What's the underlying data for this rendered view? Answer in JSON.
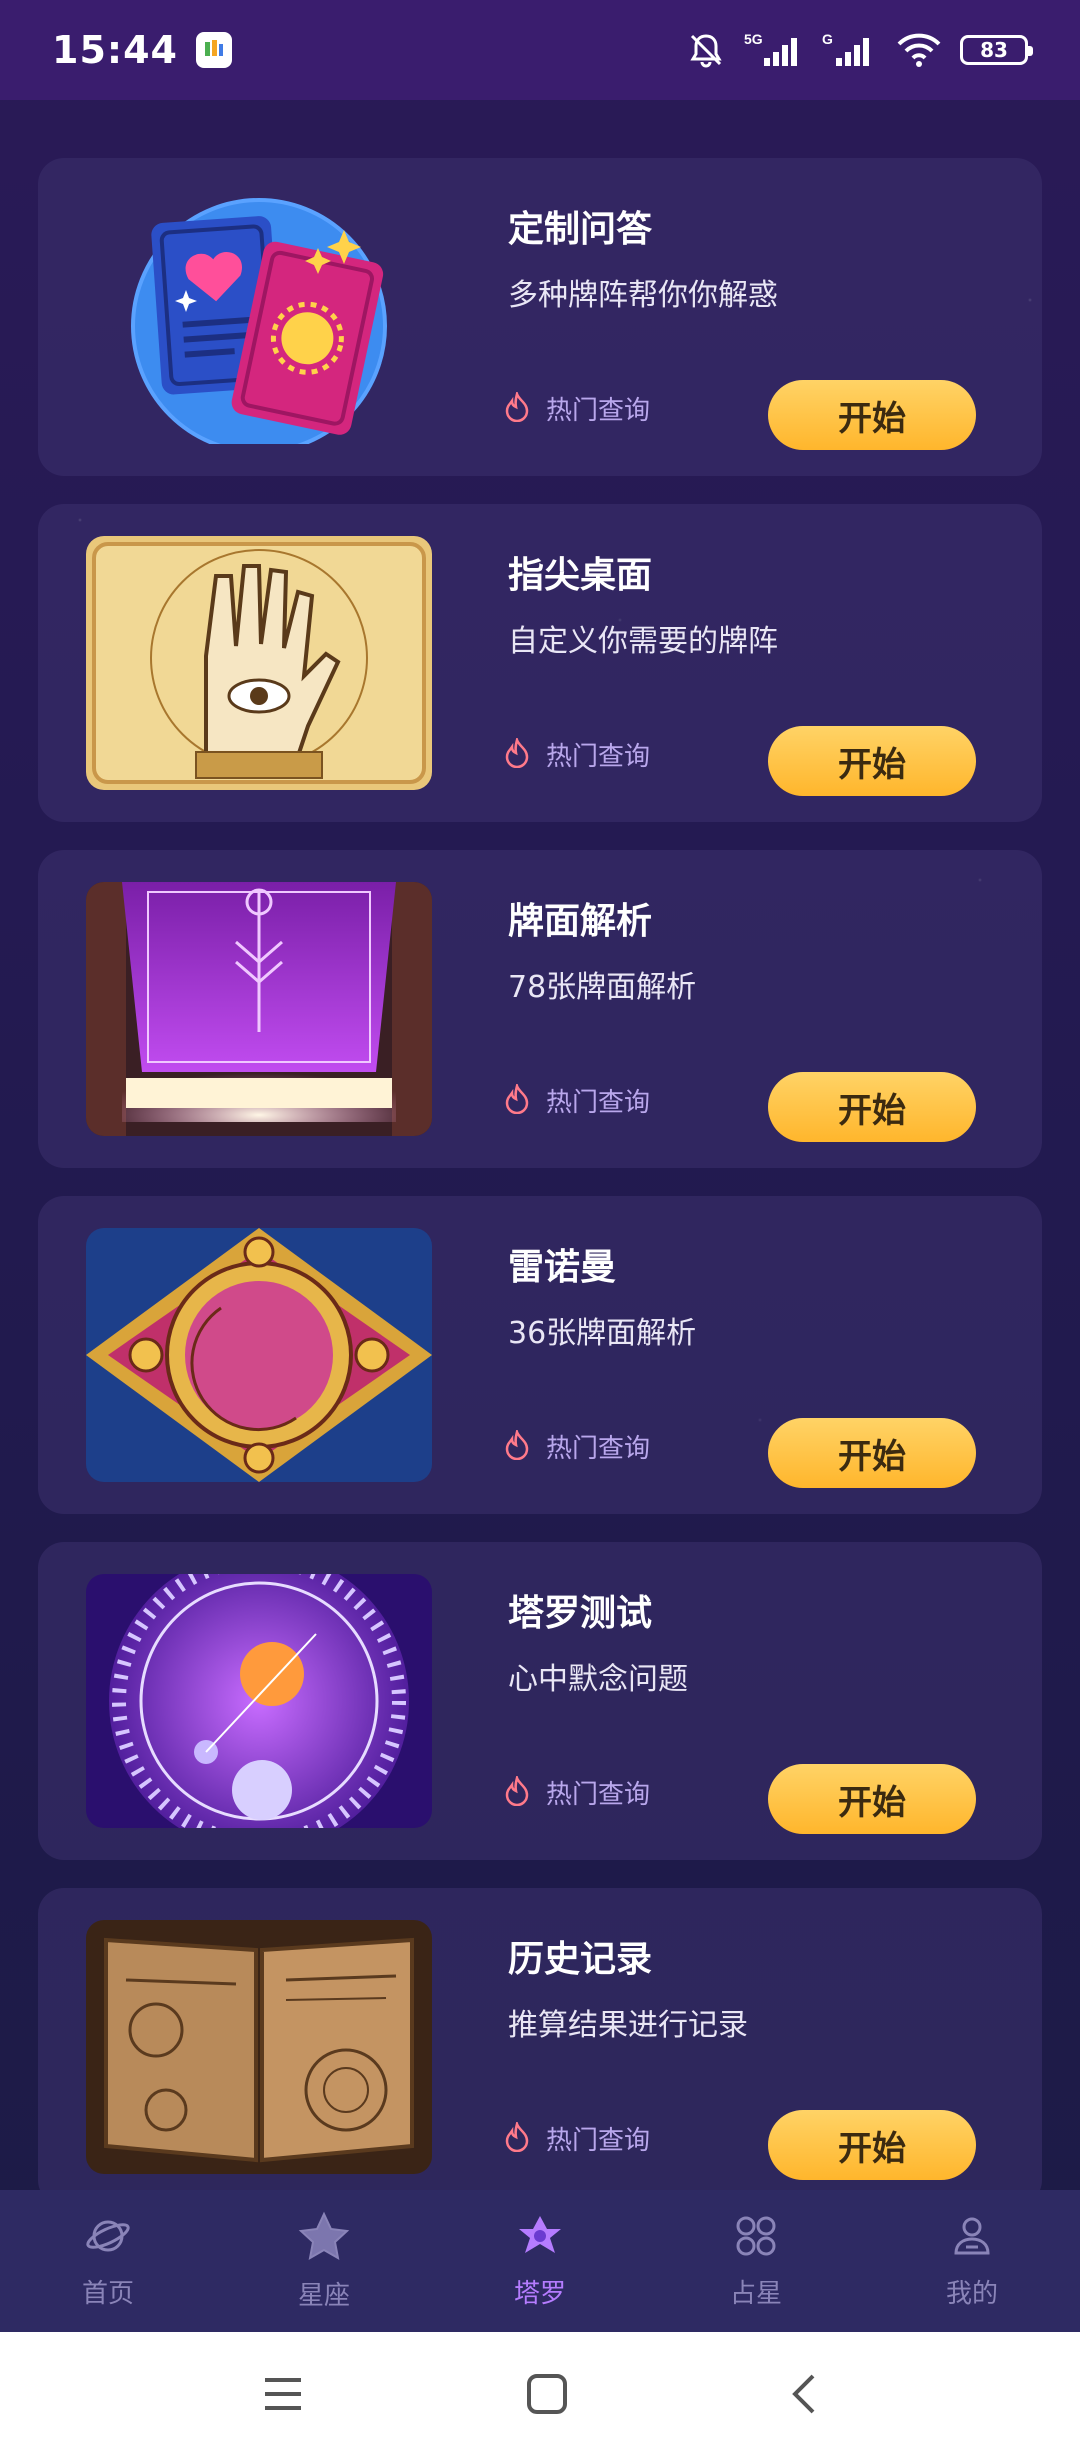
{
  "status_bar": {
    "time": "15:44",
    "battery": "83",
    "icons": [
      "app-icon",
      "bell-muted-icon",
      "signal-5g-icon",
      "signal-g-icon",
      "wifi-icon",
      "battery-icon"
    ]
  },
  "cards": [
    {
      "title": "定制问答",
      "subtitle": "多种牌阵帮你你解惑",
      "hot_label": "热门查询",
      "button_label": "开始",
      "thumb": "tarot-cards-illustration"
    },
    {
      "title": "指尖桌面",
      "subtitle": "自定义你需要的牌阵",
      "hot_label": "热门查询",
      "button_label": "开始",
      "thumb": "palmistry-alchemy-image"
    },
    {
      "title": "牌面解析",
      "subtitle": "78张牌面解析",
      "hot_label": "热门查询",
      "button_label": "开始",
      "thumb": "glowing-purple-tarot-card"
    },
    {
      "title": "雷诺曼",
      "subtitle": "36张牌面解析",
      "hot_label": "热门查询",
      "button_label": "开始",
      "thumb": "sun-moon-mandala-image"
    },
    {
      "title": "塔罗测试",
      "subtitle": "心中默念问题",
      "hot_label": "热门查询",
      "button_label": "开始",
      "thumb": "zodiac-planets-wheel"
    },
    {
      "title": "历史记录",
      "subtitle": "推算结果进行记录",
      "hot_label": "热门查询",
      "button_label": "开始",
      "thumb": "ancient-book-image"
    }
  ],
  "tabbar": [
    {
      "label": "首页",
      "icon": "planet-icon",
      "active": false
    },
    {
      "label": "星座",
      "icon": "star-icon",
      "active": false
    },
    {
      "label": "塔罗",
      "icon": "hexagram-icon",
      "active": true
    },
    {
      "label": "占星",
      "icon": "grid-icon",
      "active": false
    },
    {
      "label": "我的",
      "icon": "user-icon",
      "active": false
    }
  ],
  "colors": {
    "accent": "#b57cff",
    "button": "#ffc24a",
    "card": "#3c326e",
    "tabbar": "#2e2a63"
  }
}
